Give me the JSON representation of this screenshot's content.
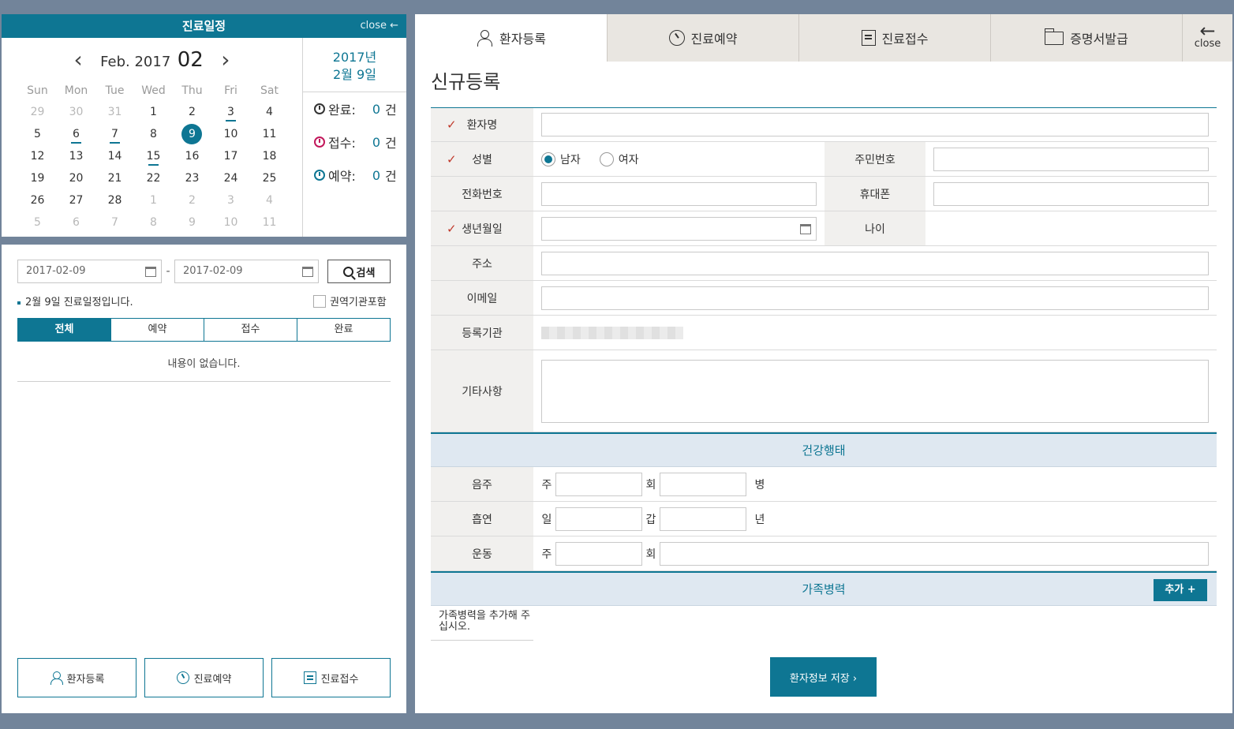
{
  "calendar": {
    "title": "진료일정",
    "close_label": "close ←",
    "month_label": "Feb. 2017",
    "month_num": "02",
    "weekdays": [
      "Sun",
      "Mon",
      "Tue",
      "Wed",
      "Thu",
      "Fri",
      "Sat"
    ],
    "weeks": [
      [
        "29",
        "30",
        "31",
        "1",
        "2",
        "3",
        "4"
      ],
      [
        "5",
        "6",
        "7",
        "8",
        "9",
        "10",
        "11"
      ],
      [
        "12",
        "13",
        "14",
        "15",
        "16",
        "17",
        "18"
      ],
      [
        "19",
        "20",
        "21",
        "22",
        "23",
        "24",
        "25"
      ],
      [
        "26",
        "27",
        "28",
        "1",
        "2",
        "3",
        "4"
      ],
      [
        "5",
        "6",
        "7",
        "8",
        "9",
        "10",
        "11"
      ]
    ],
    "selected_year": "2017년",
    "selected_day": "2월 9일",
    "stats": {
      "done_label": "완료:",
      "done_count": "0",
      "done_unit": "건",
      "recv_label": "접수:",
      "recv_count": "0",
      "recv_unit": "건",
      "resv_label": "예약:",
      "resv_count": "0",
      "resv_unit": "건"
    }
  },
  "schedule": {
    "date_from": "2017-02-09",
    "date_sep": "-",
    "date_to": "2017-02-09",
    "search_label": "검색",
    "notice": "2월 9일 진료일정입니다.",
    "include_region_label": "권역기관포함",
    "filter_tabs": [
      "전체",
      "예약",
      "접수",
      "완료"
    ],
    "empty_message": "내용이 없습니다.",
    "buttons": {
      "register": "환자등록",
      "reserve": "진료예약",
      "reception": "진료접수"
    }
  },
  "main": {
    "tabs": [
      "환자등록",
      "진료예약",
      "진료접수",
      "증명서발급"
    ],
    "close_arrow": "←",
    "close_label": "close",
    "page_title": "신규등록",
    "fields": {
      "name": "환자명",
      "gender": "성별",
      "male": "남자",
      "female": "여자",
      "resident_no": "주민번호",
      "phone": "전화번호",
      "mobile": "휴대폰",
      "birth": "생년월일",
      "age": "나이",
      "address": "주소",
      "email": "이메일",
      "institution": "등록기관",
      "notes": "기타사항"
    },
    "health": {
      "title": "건강행태",
      "drinking": "음주",
      "drinking_unit1": "주",
      "drinking_unit2": "회",
      "drinking_unit3": "병",
      "smoking": "흡연",
      "smoking_unit1": "일",
      "smoking_unit2": "갑",
      "smoking_unit3": "년",
      "exercise": "운동",
      "exercise_unit1": "주",
      "exercise_unit2": "회"
    },
    "family": {
      "title": "가족병력",
      "add_label": "추가 +",
      "hint": "가족병력을 추가해 주십시오."
    },
    "save_label": "환자정보 저장 ›"
  }
}
